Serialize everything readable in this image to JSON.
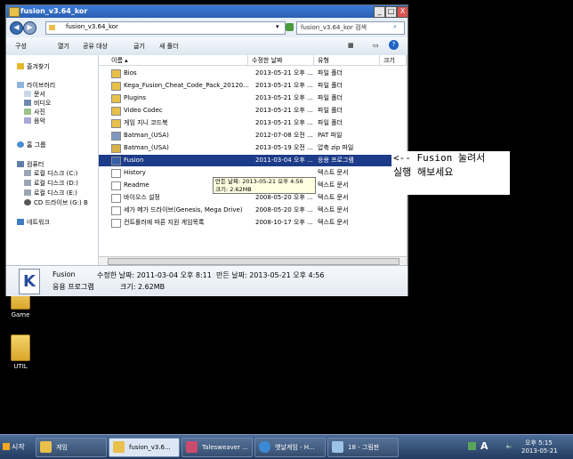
{
  "desktop": {
    "icons": [
      {
        "label": "Game"
      },
      {
        "label": "UTIL"
      }
    ]
  },
  "window": {
    "title": "fusion_v3.64_kor",
    "controls": {
      "minimize": "_",
      "maximize": "□",
      "close": "X"
    },
    "address": {
      "path": "fusion_v3.64_kor",
      "search_placeholder": "fusion_v3.64_kor 검색"
    },
    "toolbar": {
      "organize": "구성",
      "open": "열기",
      "share": "공유 대상",
      "burn": "굽기",
      "new_folder": "새 폴더"
    },
    "nav": {
      "favorites": "즐겨찾기",
      "libraries": "라이브러리",
      "lib_items": [
        "문서",
        "비디오",
        "사진",
        "음악"
      ],
      "homegroup": "홈 그룹",
      "computer": "컴퓨터",
      "drives": [
        "로컬 디스크 (C:)",
        "로컬 디스크 (D:)",
        "로컬 디스크 (E:)",
        "CD 드라이브 (G:) B"
      ],
      "network": "네트워크"
    },
    "columns": {
      "name": "이름",
      "date": "수정한 날짜",
      "type": "유형",
      "size": "크기"
    },
    "files": [
      {
        "name": "Bios",
        "date": "2013-05-21 오후 ...",
        "type": "파일 폴더",
        "icon": "folder-icon"
      },
      {
        "name": "Kega_Fusion_Cheat_Code_Pack_20120...",
        "date": "2013-05-21 오후 ...",
        "type": "파일 폴더",
        "icon": "folder-icon"
      },
      {
        "name": "Plugins",
        "date": "2013-05-21 오후 ...",
        "type": "파일 폴더",
        "icon": "folder-icon"
      },
      {
        "name": "Video Codec",
        "date": "2013-05-21 오후 ...",
        "type": "파일 폴더",
        "icon": "folder-icon"
      },
      {
        "name": "게임 지니 코드북",
        "date": "2013-05-21 오후 ...",
        "type": "파일 폴더",
        "icon": "folder-icon"
      },
      {
        "name": "Batman_(USA)",
        "date": "2012-07-08 오전 ...",
        "type": "PAT 파일",
        "icon": "file-icon"
      },
      {
        "name": "Batman_(USA)",
        "date": "2013-05-19 오전 ...",
        "type": "압축 zip 파일",
        "icon": "zip-icon"
      },
      {
        "name": "Fusion",
        "date": "2011-03-04 오후 ...",
        "type": "응용 프로그램",
        "icon": "app-icon"
      },
      {
        "name": "History",
        "date": "",
        "type": "텍스트 문서",
        "icon": "text-file-icon"
      },
      {
        "name": "Readme",
        "date": "",
        "type": "텍스트 문서",
        "icon": "text-file-icon"
      },
      {
        "name": "바이오스 설정",
        "date": "2008-05-20 오후 ...",
        "type": "텍스트 문서",
        "icon": "text-file-icon"
      },
      {
        "name": "세가 메가 드라이브(Genesis, Mega Drive)",
        "date": "2008-05-20 오후 ...",
        "type": "텍스트 문서",
        "icon": "text-file-icon"
      },
      {
        "name": "컨트롤러에 따른 지원 게임목록",
        "date": "2008-10-17 오후 ...",
        "type": "텍스트 문서",
        "icon": "text-file-icon"
      }
    ],
    "selected_index": 7,
    "tooltip": {
      "line1": "만든 날짜: 2013-05-21 오후 4:56",
      "line2": "크기: 2.62MB"
    },
    "details": {
      "name": "Fusion",
      "kind": "응용 프로그램",
      "modified": "수정한 날짜: 2011-03-04 오후 8:11",
      "created": "만든 날짜: 2013-05-21 오후 4:56",
      "size": "크기: 2.62MB"
    }
  },
  "callout": {
    "line1": "<-- Fusion 눌려서",
    "line2": "실행 해보세요"
  },
  "taskbar": {
    "start": "시작",
    "tasks": [
      {
        "label": "게임"
      },
      {
        "label": "fusion_v3.6..."
      },
      {
        "label": "Talesweaver ..."
      },
      {
        "label": "옛날게임 - H..."
      },
      {
        "label": "18 - 그림판"
      }
    ],
    "tray": {
      "ime": "A",
      "time": "오후 5:15",
      "date": "2013-05-21"
    }
  },
  "colors": {
    "selection": "#1c3b88",
    "taskbar": "#223a5e",
    "titlebar": "#2b5fb3"
  }
}
